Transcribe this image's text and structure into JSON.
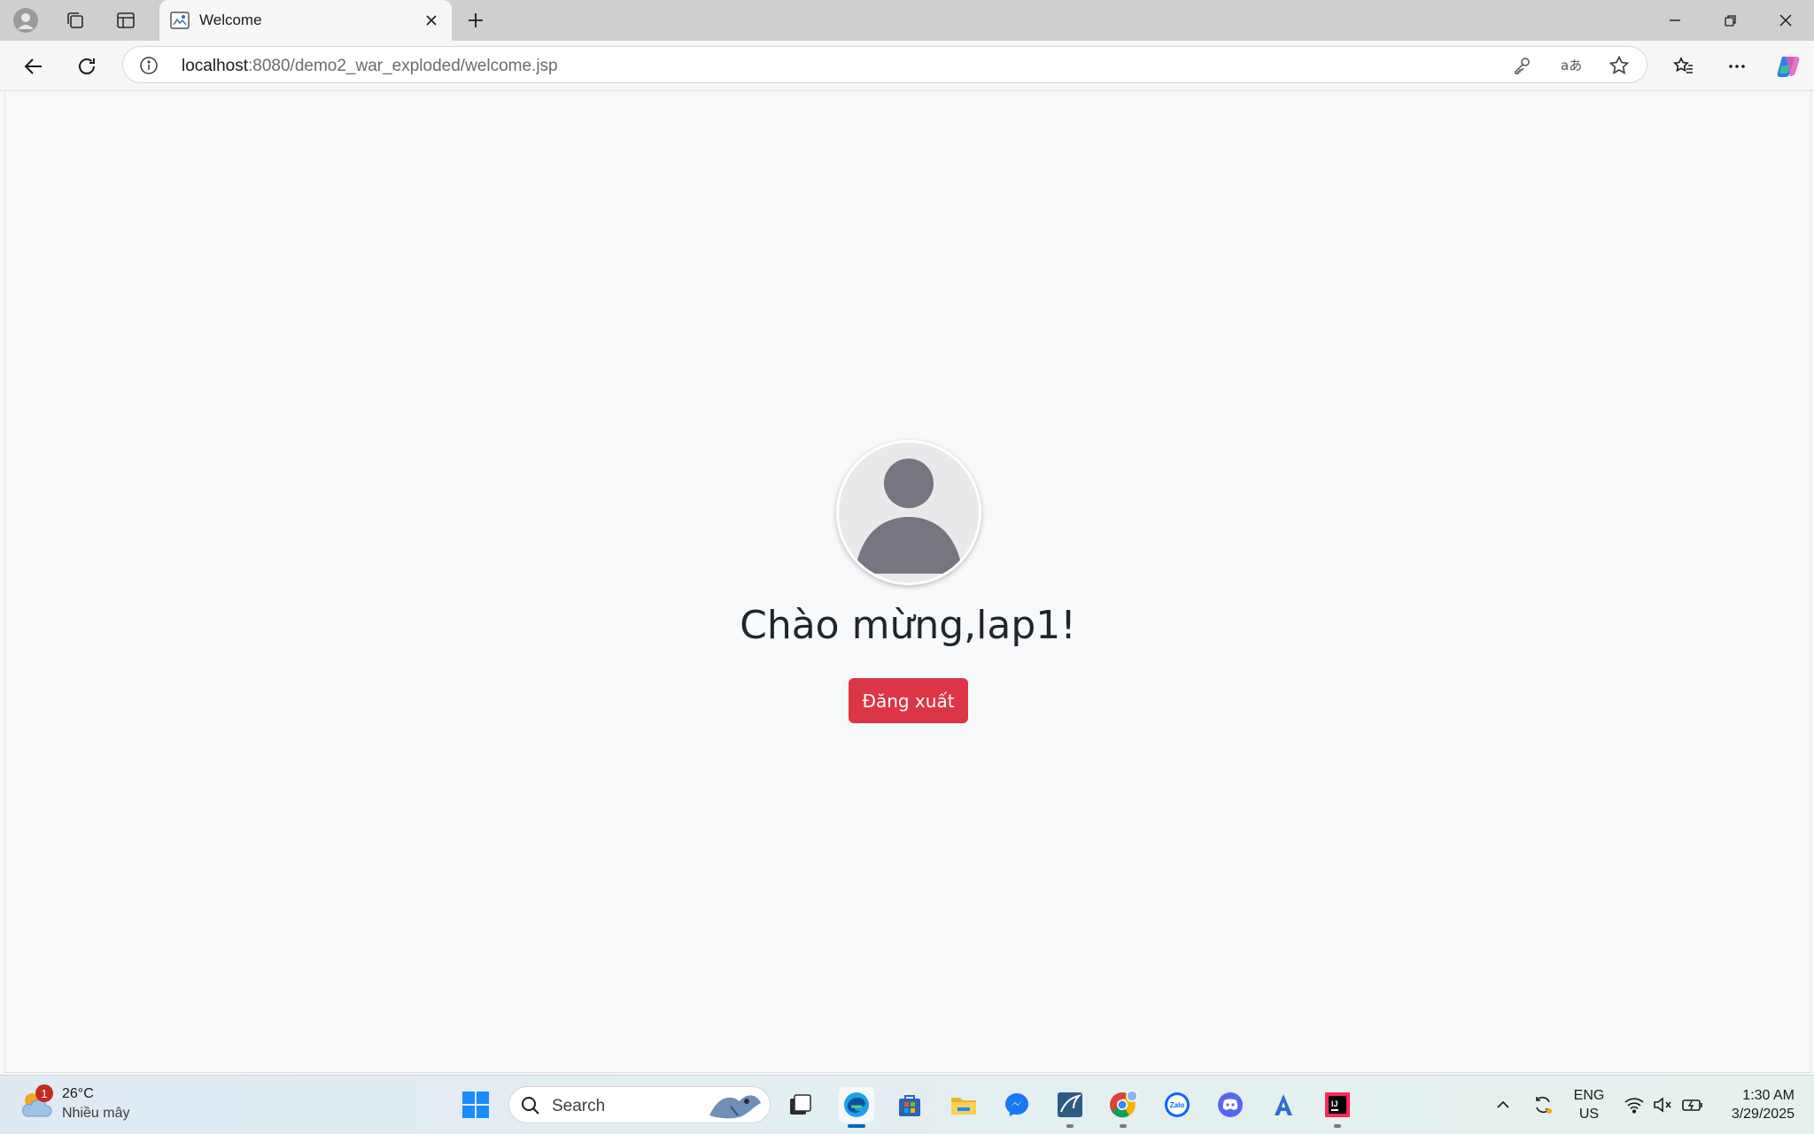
{
  "browser": {
    "tab": {
      "title": "Welcome"
    },
    "address": {
      "host": "localhost",
      "path": ":8080/demo2_war_exploded/welcome.jsp"
    }
  },
  "page": {
    "greeting": "Chào mừng,lap1!",
    "logout_label": "Đăng xuất",
    "colors": {
      "background": "#f8f9fa",
      "logout_button": "#dc3545",
      "heading": "#212529"
    }
  },
  "taskbar": {
    "weather": {
      "badge": "1",
      "temperature": "26°C",
      "condition": "Nhiều mây"
    },
    "search_placeholder": "Search",
    "apps": [
      "start-icon",
      "task-view-icon",
      "edge-icon",
      "store-icon",
      "file-explorer-icon",
      "messenger-icon",
      "mysql-workbench-icon",
      "chrome-icon",
      "zalo-icon",
      "discord-icon",
      "translate-icon",
      "intellij-icon"
    ],
    "language": {
      "line1": "ENG",
      "line2": "US"
    },
    "clock": {
      "time": "1:30 AM",
      "date": "3/29/2025"
    }
  }
}
